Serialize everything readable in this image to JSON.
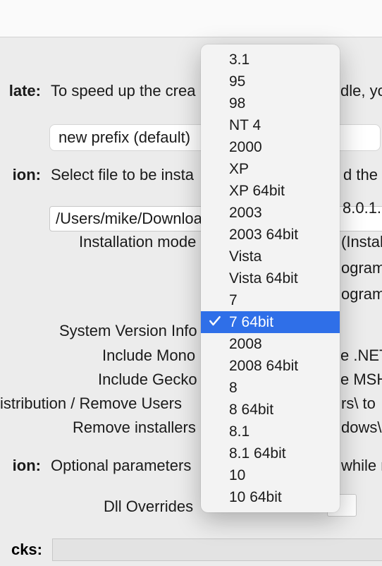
{
  "toolbar": {},
  "labels": {
    "template": "late:",
    "installation": "ion:",
    "options": "ion:",
    "tricks": "cks:"
  },
  "template": {
    "desc": "To speed up the crea",
    "desc_tail": "dle, yo",
    "select_value": "new prefix (default)"
  },
  "install": {
    "desc": "Select file to be insta",
    "desc_tail": "d the",
    "path": "/Users/mike/Downloa",
    "path_tail": "8.0.1."
  },
  "lines": {
    "mode_left": "Installation mode",
    "mode_right": "(Instal",
    "prog1_right": "ogram",
    "prog2_right": "ogram",
    "sysver": "System Version Info",
    "mono_left": "Include Mono",
    "mono_right": "e .NET",
    "gecko_left": "Include Gecko",
    "gecko_right": "e MSH",
    "dist_left": "istribution / Remove Users",
    "dist_right": "rs\\ to",
    "remove_left": "Remove installers",
    "remove_right": "dows\\",
    "optparams": "Optional parameters",
    "optparams_right": "while r",
    "dll": "Dll Overrides"
  },
  "dropdown": {
    "options": [
      "3.1",
      "95",
      "98",
      "NT 4",
      "2000",
      "XP",
      "XP 64bit",
      "2003",
      "2003 64bit",
      "Vista",
      "Vista 64bit",
      "7",
      "7 64bit",
      "2008",
      "2008 64bit",
      "8",
      "8 64bit",
      "8.1",
      "8.1 64bit",
      "10",
      "10 64bit"
    ],
    "selected": "7 64bit"
  }
}
